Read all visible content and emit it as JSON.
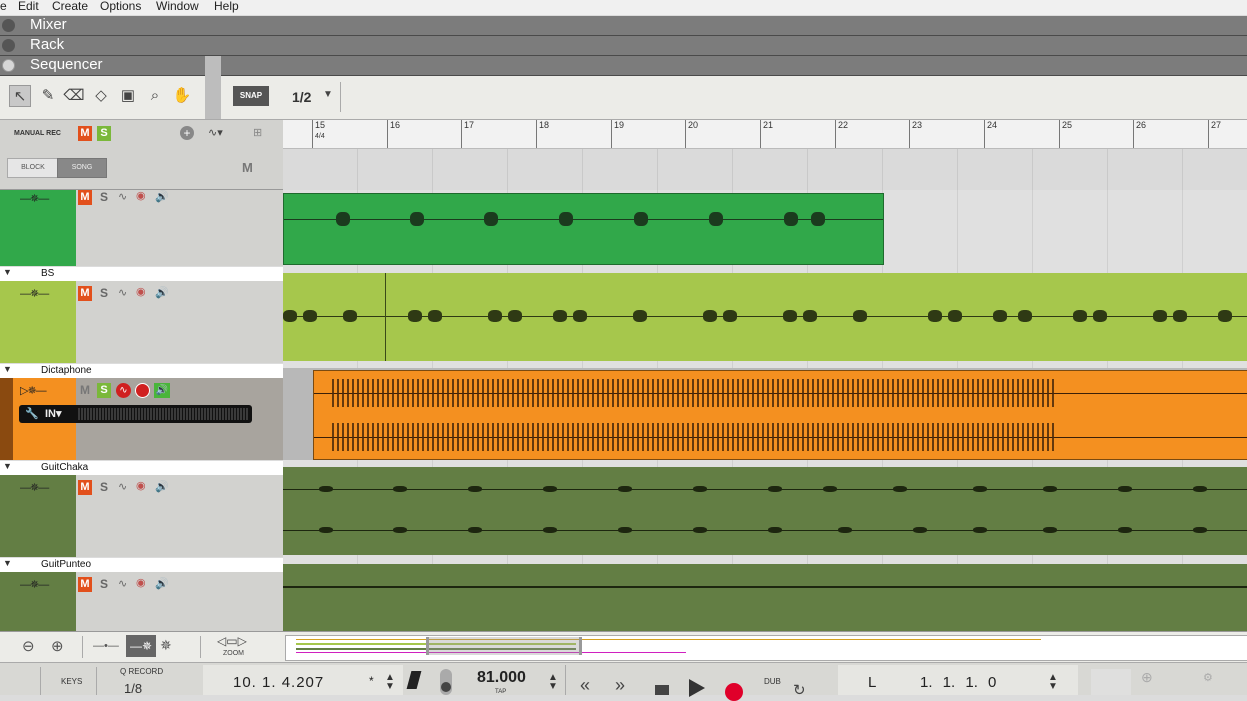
{
  "menu": [
    "e",
    "Edit",
    "Create",
    "Options",
    "Window",
    "Help"
  ],
  "sections": {
    "mixer": "Mixer",
    "rack": "Rack",
    "sequencer": "Sequencer"
  },
  "toolbar": {
    "snap_label": "SNAP",
    "snap_value": "1/2"
  },
  "panel": {
    "manual_rec": "MANUAL REC",
    "m": "M",
    "s": "S",
    "block": "BLOCK",
    "song": "SONG",
    "m_big": "M"
  },
  "ruler": {
    "bars": [
      "15",
      "16",
      "17",
      "18",
      "19",
      "20",
      "21",
      "22",
      "23",
      "24",
      "25",
      "26",
      "27"
    ],
    "signature": "4/4"
  },
  "tracks": [
    {
      "name": "",
      "color": "#31a84a",
      "m": "M",
      "s": "S"
    },
    {
      "name": "BS",
      "color": "#a6c74c",
      "m": "M",
      "s": "S"
    },
    {
      "name": "Dictaphone",
      "color": "#f49020",
      "m": "M",
      "s": "S",
      "input": "IN"
    },
    {
      "name": "GuitChaka",
      "color": "#637e44",
      "m": "M",
      "s": "S"
    },
    {
      "name": "GuitPunteo",
      "color": "#637e44",
      "m": "M",
      "s": "S"
    }
  ],
  "bottom": {
    "zoom": "ZOOM"
  },
  "transport": {
    "keys": "KEYS",
    "q_record": "Q RECORD",
    "q_value": "1/8",
    "position": "10. 1. 4.207",
    "tempo": "81.000",
    "tap": "TAP",
    "dub": "DUB",
    "loop_l": "L",
    "loop_pos": "1. 1. 1. 0"
  }
}
